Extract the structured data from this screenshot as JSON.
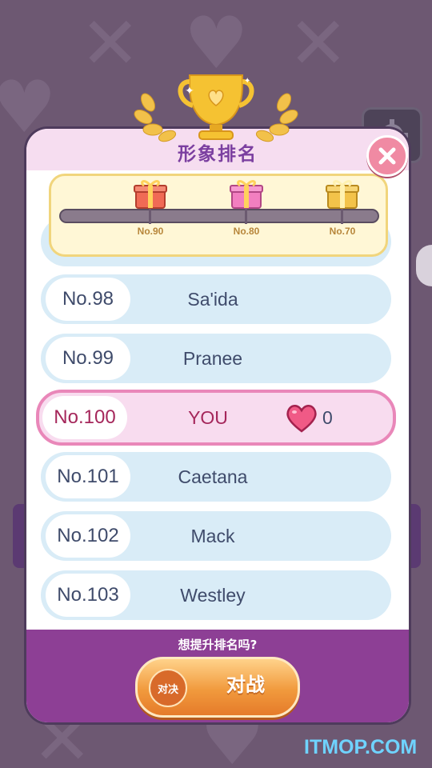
{
  "title": "形象排名",
  "progress": {
    "milestones": [
      {
        "label": "No.90",
        "gift_color": "#f06a55"
      },
      {
        "label": "No.80",
        "gift_color": "#f27fc0"
      },
      {
        "label": "No.70",
        "gift_color": "#f3c34a"
      }
    ]
  },
  "rankings": [
    {
      "rank": "No.98",
      "name": "Sa'ida"
    },
    {
      "rank": "No.99",
      "name": "Pranee"
    },
    {
      "rank": "No.100",
      "name": "YOU",
      "hearts": "0",
      "is_player": true
    },
    {
      "rank": "No.101",
      "name": "Caetana"
    },
    {
      "rank": "No.102",
      "name": "Mack"
    },
    {
      "rank": "No.103",
      "name": "Westley"
    }
  ],
  "footer": {
    "prompt": "想提升排名吗?",
    "battle_badge": "对决",
    "battle_label": "对战"
  },
  "watermark": "ITMOP.COM",
  "colors": {
    "accent": "#7b3fa0",
    "player_highlight": "#e987b9",
    "footer": "#8d3f95",
    "button": "#f19a3d"
  }
}
